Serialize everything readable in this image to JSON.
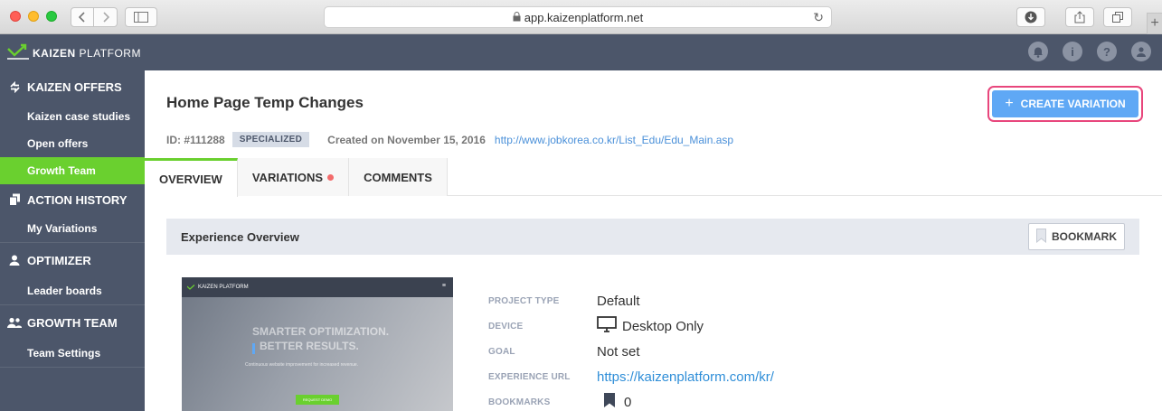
{
  "browser": {
    "url": "app.kaizenplatform.net",
    "colors": {
      "close": "#ff5f57",
      "minimize": "#ffbd2e",
      "maximize": "#28c940"
    }
  },
  "header": {
    "logo_bold": "KAIZEN",
    "logo_light": "PLATFORM",
    "icons": [
      "bell-icon",
      "info-icon",
      "help-icon",
      "user-icon"
    ]
  },
  "sidebar": {
    "sections": [
      {
        "label": "KAIZEN OFFERS",
        "icon": "arrows-icon",
        "items": [
          {
            "label": "Kaizen case studies",
            "active": false
          },
          {
            "label": "Open offers",
            "active": false
          },
          {
            "label": "Growth Team",
            "active": true
          }
        ]
      },
      {
        "label": "ACTION HISTORY",
        "icon": "copy-icon",
        "items": [
          {
            "label": "My Variations",
            "active": false
          }
        ]
      },
      {
        "label": "OPTIMIZER",
        "icon": "person-icon",
        "items": [
          {
            "label": "Leader boards",
            "active": false
          }
        ]
      },
      {
        "label": "GROWTH TEAM",
        "icon": "people-icon",
        "items": [
          {
            "label": "Team Settings",
            "active": false
          }
        ]
      }
    ],
    "active_color": "#6ad02f"
  },
  "main": {
    "title": "Home Page Temp Changes",
    "id_label": "ID: #111288",
    "badge": "SPECIALIZED",
    "created": "Created on November 15, 2016",
    "link": "http://www.jobkorea.co.kr/List_Edu/Edu_Main.asp",
    "create_button": "CREATE VARIATION",
    "tabs": [
      {
        "label": "OVERVIEW",
        "active": true,
        "dot": false
      },
      {
        "label": "VARIATIONS",
        "active": false,
        "dot": true
      },
      {
        "label": "COMMENTS",
        "active": false,
        "dot": false
      }
    ],
    "panel_title": "Experience Overview",
    "bookmark_button": "BOOKMARK",
    "thumbnail": {
      "logo": "KAIZEN PLATFORM",
      "headline_1": "SMARTER OPTIMIZATION.",
      "headline_2": "BETTER RESULTS.",
      "subline": "Continuous website improvement for increased revenue.",
      "cta": "REQUEST DEMO"
    },
    "details": [
      {
        "label": "PROJECT TYPE",
        "value": "Default"
      },
      {
        "label": "DEVICE",
        "value": "Desktop Only"
      },
      {
        "label": "GOAL",
        "value": "Not set"
      },
      {
        "label": "EXPERIENCE URL",
        "value": "https://kaizenplatform.com/kr/"
      },
      {
        "label": "BOOKMARKS",
        "value": "0"
      }
    ]
  }
}
